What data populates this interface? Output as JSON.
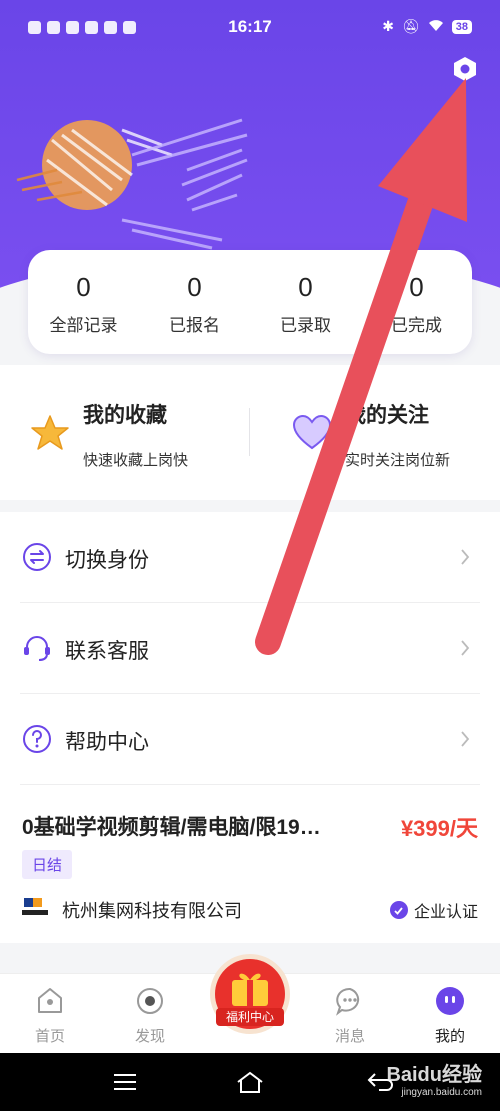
{
  "status_bar": {
    "time": "16:17",
    "battery": "38"
  },
  "stats": [
    {
      "num": "0",
      "label": "全部记录"
    },
    {
      "num": "0",
      "label": "已报名"
    },
    {
      "num": "0",
      "label": "已录取"
    },
    {
      "num": "0",
      "label": "已完成"
    }
  ],
  "favorites": {
    "title": "我的收藏",
    "sub": "快速收藏上岗快"
  },
  "follows": {
    "title": "我的关注",
    "sub": "实时关注岗位新"
  },
  "menu": [
    {
      "label": "切换身份"
    },
    {
      "label": "联系客服"
    },
    {
      "label": "帮助中心"
    }
  ],
  "job": {
    "title": "0基础学视频剪辑/需电脑/限19…",
    "price": "¥399/天",
    "tag": "日结",
    "company": "杭州集网科技有限公司",
    "verified": "企业认证"
  },
  "tabs": [
    {
      "label": "首页"
    },
    {
      "label": "发现"
    },
    {
      "label": "消息"
    },
    {
      "label": "我的"
    }
  ],
  "welfare_label": "福利中心",
  "watermark": {
    "main": "Baidu经验",
    "sub": "jingyan.baidu.com"
  },
  "colors": {
    "primary": "#6a45e8",
    "price": "#f0463a",
    "arrow": "#e8505b"
  }
}
